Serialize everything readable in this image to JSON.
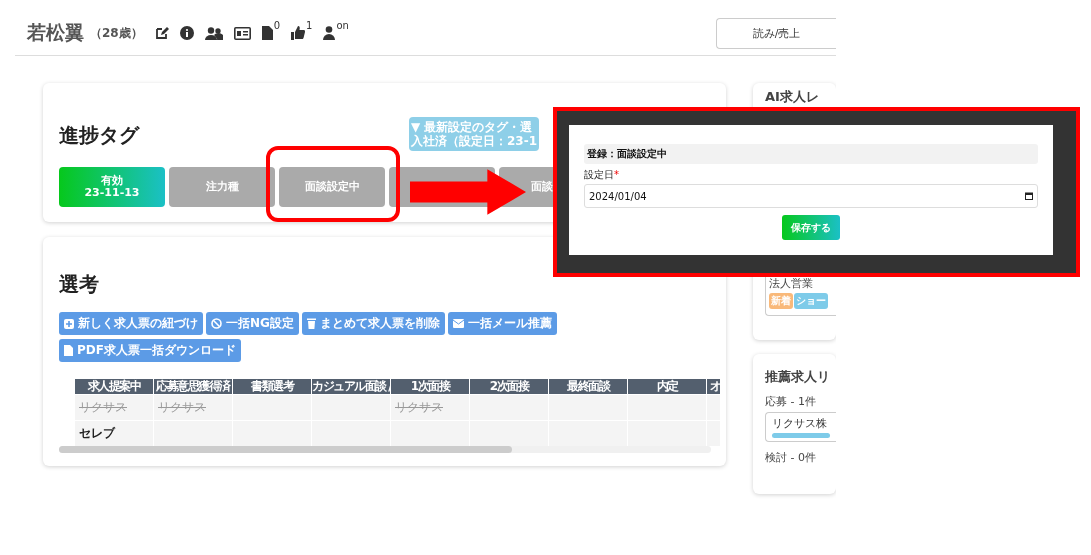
{
  "header": {
    "name": "若松翼",
    "age": "（28歳）",
    "badges": [
      {
        "kind": "edit"
      },
      {
        "kind": "info"
      },
      {
        "kind": "users"
      },
      {
        "kind": "card"
      },
      {
        "kind": "file",
        "count": "0"
      },
      {
        "kind": "thumb",
        "count": "1"
      },
      {
        "kind": "user",
        "count": "on"
      }
    ],
    "button": "読み/売上"
  },
  "progress": {
    "title": "進捗タグ",
    "info_lines": [
      "▼ 最新設定のタグ・選",
      "入社済（設定日：23-1"
    ],
    "tags": [
      {
        "label": "有効",
        "date": "23-11-13",
        "selected": true
      },
      {
        "label": "注力種",
        "selected": false
      },
      {
        "label": "面談設定中",
        "selected": false
      },
      {
        "selected": false
      },
      {
        "label": "面談",
        "selected": false
      }
    ]
  },
  "selection": {
    "title": "選考",
    "buttons": [
      {
        "kind": "link",
        "label": "新しく求人票の紐づけ"
      },
      {
        "kind": "ban",
        "label": "一括NG設定"
      },
      {
        "kind": "trash",
        "label": "まとめて求人票を削除"
      },
      {
        "kind": "mail",
        "label": "一括メール推薦"
      },
      {
        "kind": "pdf",
        "label": "PDF求人票一括ダウンロード"
      }
    ],
    "table": {
      "columns": [
        "求人提案中",
        "応募意思獲得済",
        "書類選考",
        "カジュアル面談 /",
        "1次面接",
        "2次面接",
        "最終面談",
        "内定",
        "オ"
      ],
      "rows": [
        {
          "struck": true,
          "cells": [
            "リクサス",
            "リクサス",
            null,
            null,
            "リクサス",
            null,
            null,
            null,
            null
          ]
        },
        {
          "struck": false,
          "cells": [
            "セレブ",
            null,
            null,
            null,
            null,
            null,
            null,
            null,
            null
          ]
        }
      ]
    }
  },
  "ai_panel": {
    "title": "AI求人レ",
    "job": "法人営業",
    "tags": [
      {
        "label": "新着",
        "color": "#f9b97a"
      },
      {
        "label": "ショー",
        "color": "#7ecbe9"
      }
    ]
  },
  "recommend": {
    "title": "推薦求人リ",
    "applied": "応募 - 1件",
    "company": "リクサス株",
    "considering": "検討 - 0件"
  },
  "modal": {
    "heading": "登録：面談設定中",
    "field_label": "設定日",
    "required_mark": "*",
    "date": "2024/01/04",
    "save": "保存する"
  }
}
